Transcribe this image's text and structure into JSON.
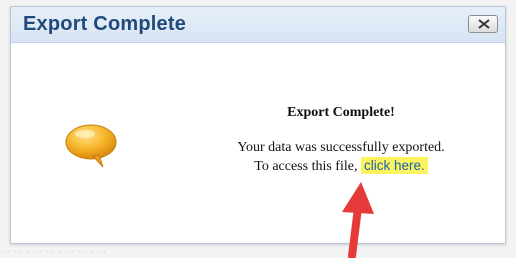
{
  "dialog": {
    "title": "Export Complete",
    "close_icon": "close-icon",
    "heading": "Export Complete!",
    "line1": "Your data was successfully exported.",
    "line2_prefix": "To access this file,",
    "link_label": "click here.",
    "icon": "speech-bubble-icon"
  },
  "colors": {
    "title_bar": "#dbe6f4",
    "title_text": "#1f4a79",
    "link_highlight": "#fcf45f",
    "link_text": "#1b5fae",
    "annotation_arrow": "#e53a3a",
    "speech_bubble": "#f3a516"
  }
}
